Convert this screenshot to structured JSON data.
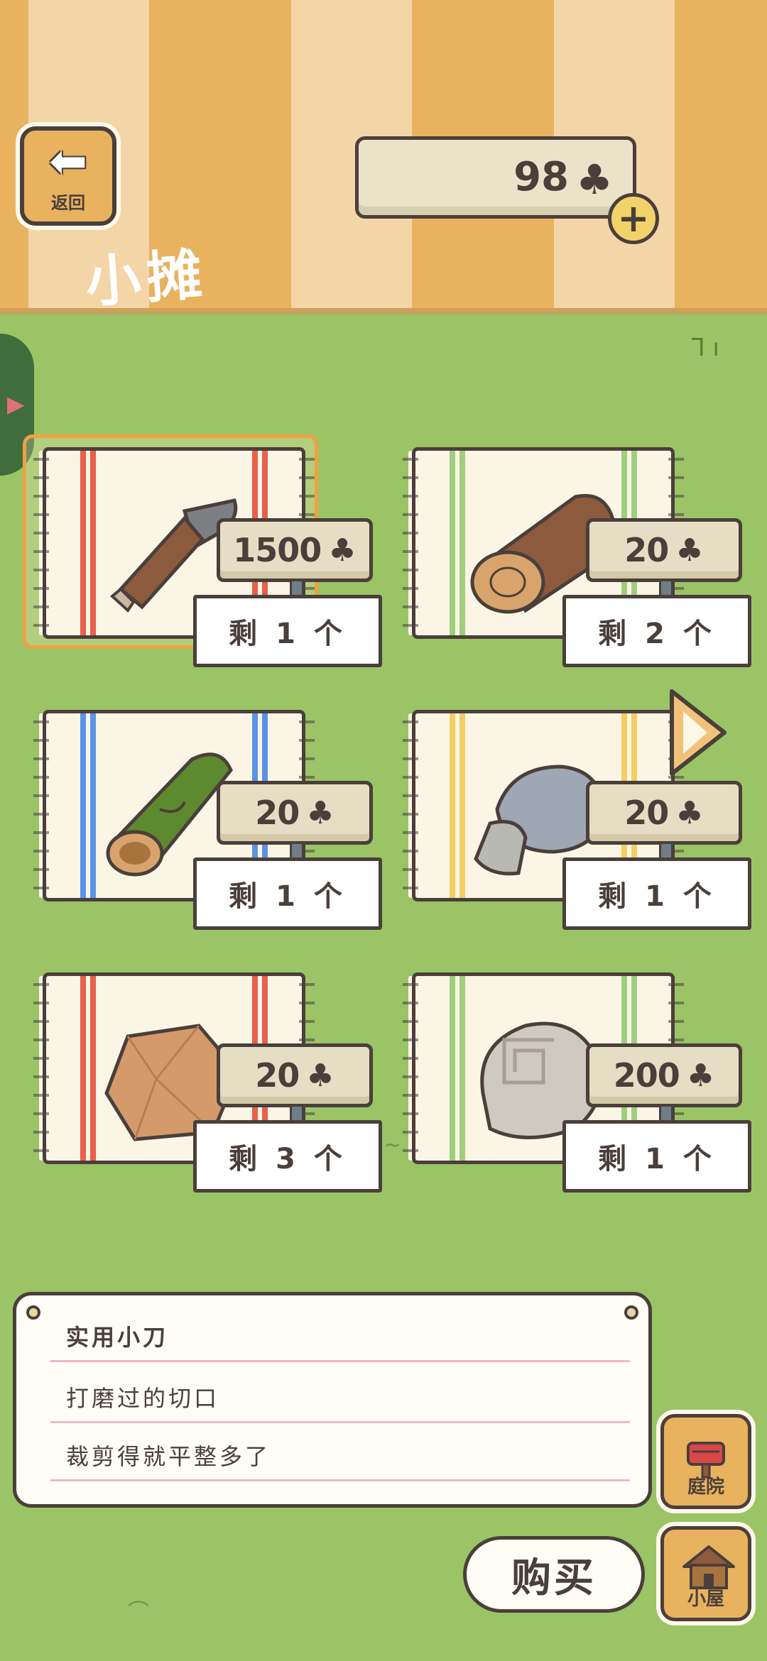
{
  "header": {
    "back_label": "返回",
    "back_icon": "left-arrow-icon",
    "title": "小摊",
    "currency": {
      "amount": "98",
      "icon": "clover-icon",
      "symbol": "♣"
    },
    "add_label": "+"
  },
  "items": [
    {
      "name": "knife",
      "price": "1500",
      "clover": "♣",
      "stock": "剩 1 个",
      "stripe": "#e8604c",
      "selected": true
    },
    {
      "name": "log",
      "price": "20",
      "clover": "♣",
      "stock": "剩 2 个",
      "stripe": "#9fcf7e",
      "selected": false
    },
    {
      "name": "bamboo",
      "price": "20",
      "clover": "♣",
      "stock": "剩 1 个",
      "stripe": "#5b93e6",
      "selected": false
    },
    {
      "name": "gray-stone",
      "price": "20",
      "clover": "♣",
      "stock": "剩 1 个",
      "stripe": "#f3cf63",
      "selected": false
    },
    {
      "name": "clay",
      "price": "20",
      "clover": "♣",
      "stock": "剩 3 个",
      "stripe": "#e8604c",
      "selected": false
    },
    {
      "name": "spiral-stone",
      "price": "200",
      "clover": "♣",
      "stock": "剩 1 个",
      "stripe": "#9fcf7e",
      "selected": false
    }
  ],
  "description": {
    "title": "实用小刀",
    "line1": "打磨过的切口",
    "line2": "裁剪得就平整多了"
  },
  "buttons": {
    "buy": "购买",
    "yard": "庭院",
    "house": "小屋"
  },
  "colors": {
    "grass": "#9ac466",
    "awning_dark": "#e8b25e",
    "awning_light": "#f4d5a8",
    "outline": "#4a3f3a",
    "selected_frame": "#f0a044"
  }
}
